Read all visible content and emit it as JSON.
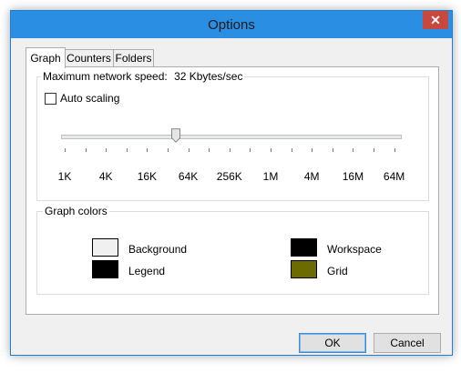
{
  "window": {
    "title": "Options",
    "close_glyph": "✕"
  },
  "tabs": [
    {
      "label": "Graph",
      "active": true
    },
    {
      "label": "Counters",
      "active": false
    },
    {
      "label": "Folders",
      "active": false
    }
  ],
  "speed": {
    "label": "Maximum network speed:",
    "value": "32 Kbytes/sec",
    "auto_scaling_label": "Auto scaling",
    "auto_scaling_checked": false,
    "ticks": [
      "1K",
      "4K",
      "16K",
      "64K",
      "256K",
      "1M",
      "4M",
      "16M",
      "64M"
    ],
    "selected_index": 3
  },
  "graph_colors": {
    "title": "Graph colors",
    "items": [
      {
        "label": "Background",
        "color": "#f0f0f0"
      },
      {
        "label": "Legend",
        "color": "#000000"
      },
      {
        "label": "Workspace",
        "color": "#000000"
      },
      {
        "label": "Grid",
        "color": "#6b6b00"
      }
    ]
  },
  "buttons": {
    "ok": "OK",
    "cancel": "Cancel"
  }
}
